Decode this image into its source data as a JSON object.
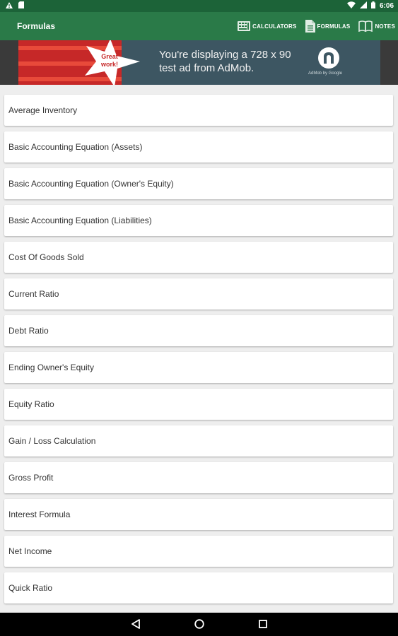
{
  "status_bar": {
    "time": "6:06"
  },
  "app_bar": {
    "title": "Formulas",
    "actions": [
      {
        "label": "CALCULATORS",
        "icon": "calculator-icon"
      },
      {
        "label": "FORMULAS",
        "icon": "document-icon"
      },
      {
        "label": "NOTES",
        "icon": "book-icon"
      }
    ]
  },
  "ad": {
    "badge": "Great work!",
    "text_line1": "You're displaying a 728 x 90",
    "text_line2": "test ad from AdMob.",
    "caption": "AdMob by Google"
  },
  "formulas": [
    "Average Inventory",
    "Basic Accounting Equation (Assets)",
    "Basic Accounting Equation (Owner's Equity)",
    "Basic Accounting Equation (Liabilities)",
    "Cost Of Goods Sold",
    "Current Ratio",
    "Debt Ratio",
    "Ending Owner's Equity",
    "Equity Ratio",
    "Gain / Loss Calculation",
    "Gross Profit",
    "Interest Formula",
    "Net Income",
    "Quick Ratio"
  ],
  "colors": {
    "status_bar": "#1c6338",
    "app_bar": "#2a7a48",
    "ad_red": "#c62828",
    "ad_bg": "#3d5662"
  }
}
